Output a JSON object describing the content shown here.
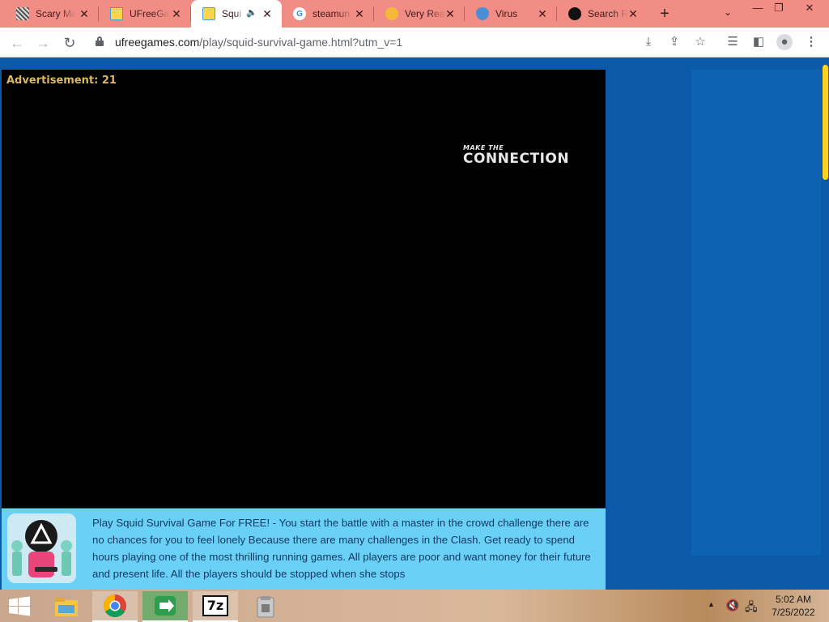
{
  "browser": {
    "tabs": [
      {
        "title": "Scary Ma",
        "favicon": "checker-favicon",
        "active": false
      },
      {
        "title": "UFreeGa",
        "favicon": "ufreegames-favicon",
        "active": false
      },
      {
        "title": "Squi",
        "favicon": "ufreegames-favicon",
        "active": true,
        "audio": true
      },
      {
        "title": "steamun",
        "favicon": "google-favicon",
        "active": false
      },
      {
        "title": "Very Rea",
        "favicon": "emoji-favicon",
        "active": false
      },
      {
        "title": "Virus",
        "favicon": "eye-favicon",
        "active": false
      },
      {
        "title": "Search R",
        "favicon": "dark-face-favicon",
        "active": false
      }
    ],
    "url_host": "ufreegames.com",
    "url_path": "/play/squid-survival-game.html?utm_v=1"
  },
  "game": {
    "ad_label": "Advertisement: 21",
    "ad_logo_small": "MAKE THE",
    "ad_logo_big": "CONNECTION"
  },
  "description": {
    "text": "Play Squid Survival Game For FREE! - You start the battle with a master in the crowd challenge there are no chances for you to feel lonely Because there are many challenges in the Clash. Get ready to spend hours playing one of the most thrilling running games. All players are poor and want money for their future and present life. All the players should be stopped when she stops"
  },
  "taskbar": {
    "items": [
      "file-explorer-icon",
      "chrome-icon",
      "transfer-app-icon",
      "7zip-icon",
      "app-icon"
    ],
    "sevenzip_label": "7z",
    "time": "5:02 AM",
    "date": "7/25/2022"
  },
  "colors": {
    "tabstrip": "#f28d86",
    "page_bg": "#0a5aa8",
    "desc_bg": "#6bd0f5",
    "scroll_thumb": "#ffd21f",
    "ad_label": "#d8b868"
  }
}
